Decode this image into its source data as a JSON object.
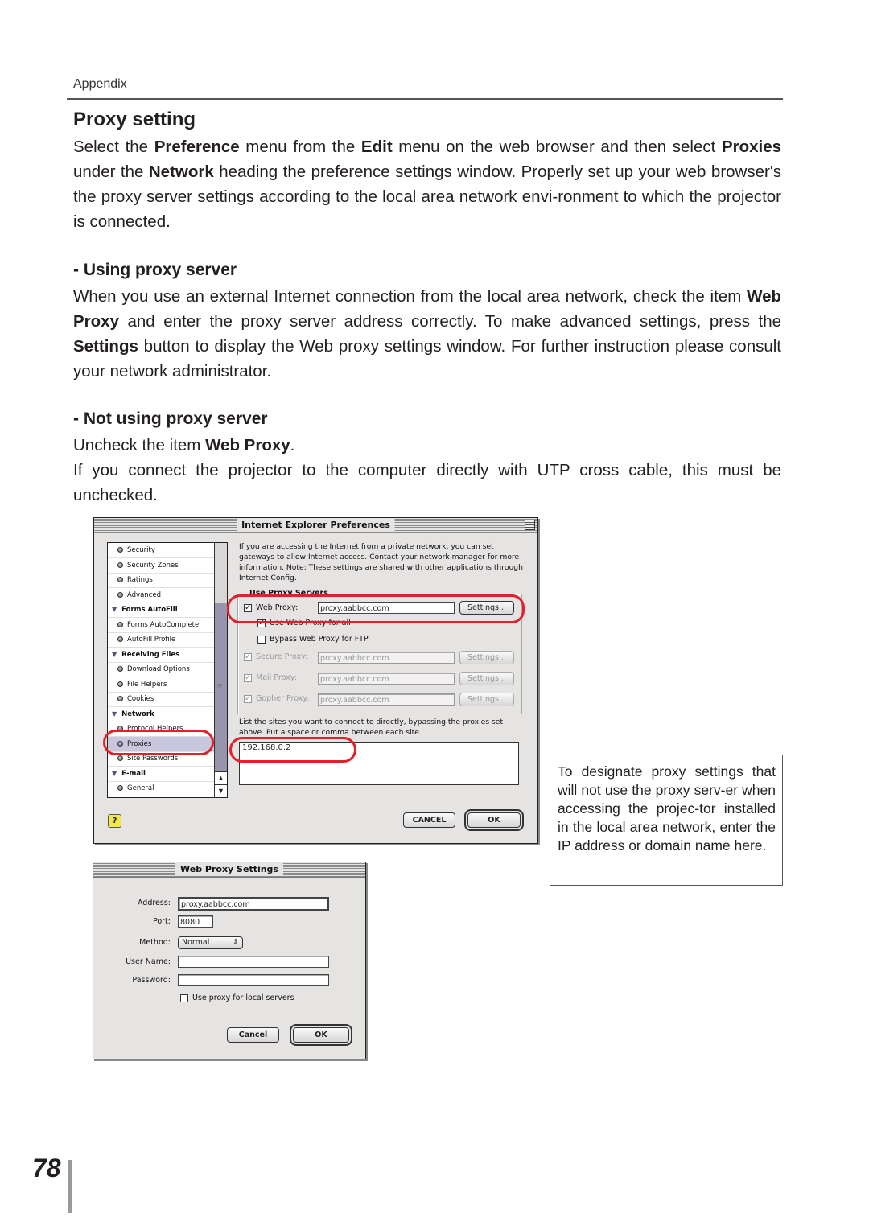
{
  "header": {
    "section": "Appendix"
  },
  "title": "Proxy setting",
  "intro": {
    "t1": "Select the ",
    "b1": "Preference",
    "t2": " menu from the ",
    "b2": "Edit",
    "t3": " menu on the web browser and then select ",
    "b3": "Proxies",
    "t4": " under the ",
    "b4": "Network",
    "t5": " heading the preference settings window. Properly set up your web browser's the proxy server settings according to the local area network envi-ronment to which the projector is connected."
  },
  "using": {
    "heading": "- Using proxy server",
    "t1": "When you use an external Internet connection from the local area network, check the item ",
    "b1": "Web Proxy",
    "t2": " and enter the proxy server address correctly. To make advanced settings, press the ",
    "b2": "Settings",
    "t3": " button to display the Web proxy settings window. For further instruction please consult your network administrator."
  },
  "not_using": {
    "heading": "- Not using proxy server",
    "line1_t": "Uncheck the item ",
    "line1_b": "Web Proxy",
    "line1_end": ".",
    "line2": "If you connect the projector to the computer directly with UTP cross cable, this must be unchecked."
  },
  "ie_prefs": {
    "title": "Internet Explorer Preferences",
    "tree": [
      {
        "label": "Security",
        "type": "item"
      },
      {
        "label": "Security Zones",
        "type": "item"
      },
      {
        "label": "Ratings",
        "type": "item"
      },
      {
        "label": "Advanced",
        "type": "item"
      },
      {
        "label": "Forms AutoFill",
        "type": "head"
      },
      {
        "label": "Forms AutoComplete",
        "type": "item"
      },
      {
        "label": "AutoFill Profile",
        "type": "item"
      },
      {
        "label": "Receiving Files",
        "type": "head"
      },
      {
        "label": "Download Options",
        "type": "item"
      },
      {
        "label": "File Helpers",
        "type": "item"
      },
      {
        "label": "Cookies",
        "type": "item"
      },
      {
        "label": "Network",
        "type": "head"
      },
      {
        "label": "Protocol Helpers",
        "type": "item"
      },
      {
        "label": "Proxies",
        "type": "item",
        "selected": true
      },
      {
        "label": "Site Passwords",
        "type": "item"
      },
      {
        "label": "E-mail",
        "type": "head"
      },
      {
        "label": "General",
        "type": "item"
      }
    ],
    "description": "If you are accessing the Internet from a private network, you can set gateways to allow Internet access. Contact your network manager for more information. Note: These settings are shared with other applications through Internet Config.",
    "group_label": "Use Proxy Servers",
    "web_proxy": {
      "label": "Web Proxy:",
      "checked": true,
      "value": "proxy.aabbcc.com",
      "settings": "Settings..."
    },
    "use_for_all": {
      "label": "Use Web Proxy for all",
      "checked": true
    },
    "bypass_ftp": {
      "label": "Bypass Web Proxy for FTP",
      "checked": false
    },
    "secure_proxy": {
      "label": "Secure Proxy:",
      "checked": true,
      "value": "proxy.aabbcc.com",
      "settings": "Settings..."
    },
    "mail_proxy": {
      "label": "Mail Proxy:",
      "checked": true,
      "value": "proxy.aabbcc.com",
      "settings": "Settings..."
    },
    "gopher_proxy": {
      "label": "Gopher Proxy:",
      "checked": true,
      "value": "proxy.aabbcc.com",
      "settings": "Settings..."
    },
    "bypass_list_label": "List the sites you want to connect to directly, bypassing the proxies set above. Put a space or comma between each site.",
    "bypass_list_value": "192.168.0.2",
    "help": "?",
    "cancel": "CANCEL",
    "ok": "OK"
  },
  "web_proxy_settings": {
    "title": "Web Proxy Settings",
    "address_label": "Address:",
    "address_value": "proxy.aabbcc.com",
    "port_label": "Port:",
    "port_value": "8080",
    "method_label": "Method:",
    "method_value": "Normal",
    "username_label": "User Name:",
    "username_value": "",
    "password_label": "Password:",
    "password_value": "",
    "local_servers": {
      "label": "Use proxy for local servers",
      "checked": false
    },
    "cancel": "Cancel",
    "ok": "OK"
  },
  "callout": "To designate proxy settings that will not use the proxy serv-er when accessing the projec-tor installed in the local area network, enter the IP address or domain name here.",
  "page_number": "78",
  "colors": {
    "highlight_ring": "#e4202a",
    "dialog_bg": "#e6e3e3",
    "selected_row": "#c9c7de"
  }
}
